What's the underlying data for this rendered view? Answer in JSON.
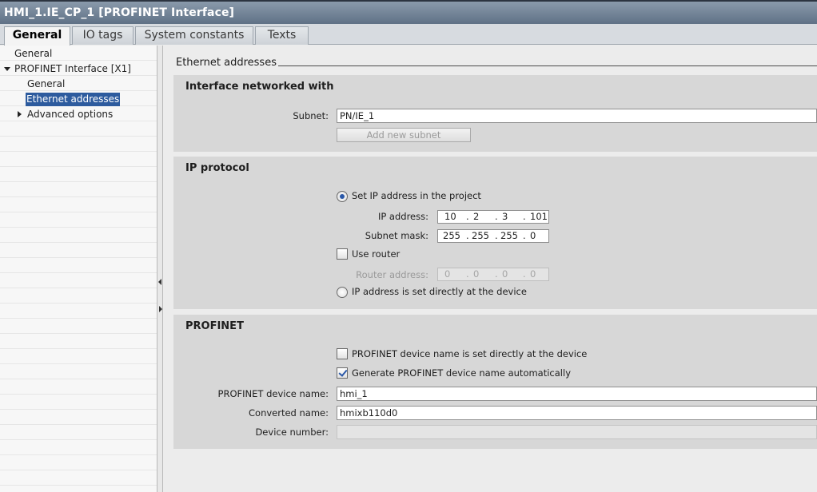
{
  "window": {
    "title": "HMI_1.IE_CP_1 [PROFINET Interface]"
  },
  "tabs": [
    {
      "label": "General",
      "active": true
    },
    {
      "label": "IO tags"
    },
    {
      "label": "System constants"
    },
    {
      "label": "Texts"
    }
  ],
  "tree": {
    "items": [
      {
        "label": "General"
      },
      {
        "label": "PROFINET Interface [X1]"
      },
      {
        "label": "General"
      },
      {
        "label": "Ethernet addresses",
        "selected": true
      },
      {
        "label": "Advanced options"
      }
    ]
  },
  "content": {
    "section_title": "Ethernet addresses",
    "networked": {
      "title": "Interface networked with",
      "subnet_label": "Subnet:",
      "subnet_value": "PN/IE_1",
      "add_subnet_button": "Add new subnet"
    },
    "ip_protocol": {
      "title": "IP protocol",
      "set_in_project": "Set IP address in the project",
      "ip_label": "IP address:",
      "ip": [
        "10",
        "2",
        "3",
        "101"
      ],
      "mask_label": "Subnet mask:",
      "mask": [
        "255",
        "255",
        "255",
        "0"
      ],
      "use_router": "Use router",
      "router_label": "Router address:",
      "router": [
        "0",
        "0",
        "0",
        "0"
      ],
      "set_at_device": "IP address is set directly at the device",
      "dot": "."
    },
    "profinet": {
      "title": "PROFINET",
      "name_at_device": "PROFINET device name is set directly at the device",
      "generate_auto": "Generate PROFINET device name automatically",
      "device_name_label": "PROFINET device name:",
      "device_name": "hmi_1",
      "converted_label": "Converted name:",
      "converted": "hmixb110d0",
      "device_number_label": "Device number:",
      "device_number": ""
    }
  },
  "colors": {
    "selection": "#2d5b9e",
    "titlebar": "#5f7186",
    "check_accent": "#2a58a8"
  }
}
